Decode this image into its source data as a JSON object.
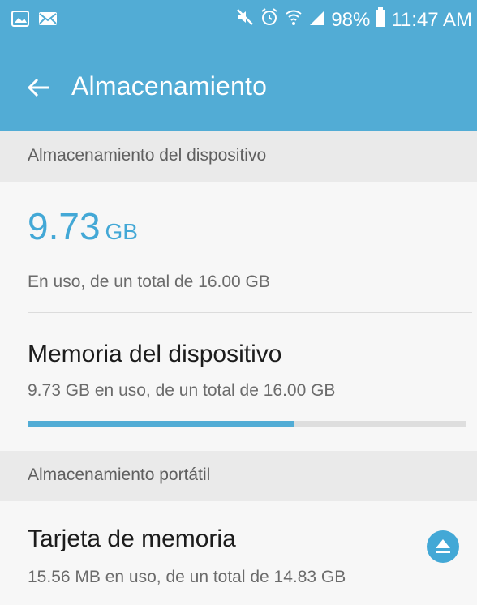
{
  "status_bar": {
    "left_icons": [
      "gallery-icon",
      "mail-icon"
    ],
    "right_icons": [
      "mute-icon",
      "alarm-icon",
      "wifi-icon",
      "signal-icon"
    ],
    "battery": "98%",
    "time": "11:47 AM"
  },
  "app_bar": {
    "title": "Almacenamiento",
    "back_icon": "arrow-left-icon"
  },
  "device_section": {
    "header": "Almacenamiento del dispositivo",
    "used_value": "9.73",
    "used_unit": "GB",
    "used_caption": "En uso, de un total de 16.00 GB",
    "memory_title": "Memoria del dispositivo",
    "memory_subtitle": "9.73 GB en uso, de un total de 16.00 GB",
    "usage_fraction": 0.608
  },
  "portable_section": {
    "header": "Almacenamiento portátil",
    "card_title": "Tarjeta de memoria",
    "card_subtitle": "15.56 MB en uso, de un total de 14.83 GB",
    "eject_icon": "eject-icon"
  },
  "colors": {
    "accent": "#52acd5",
    "accent_text": "#43a8d6",
    "section_bg": "#eaeaea",
    "background": "#f7f7f7"
  }
}
